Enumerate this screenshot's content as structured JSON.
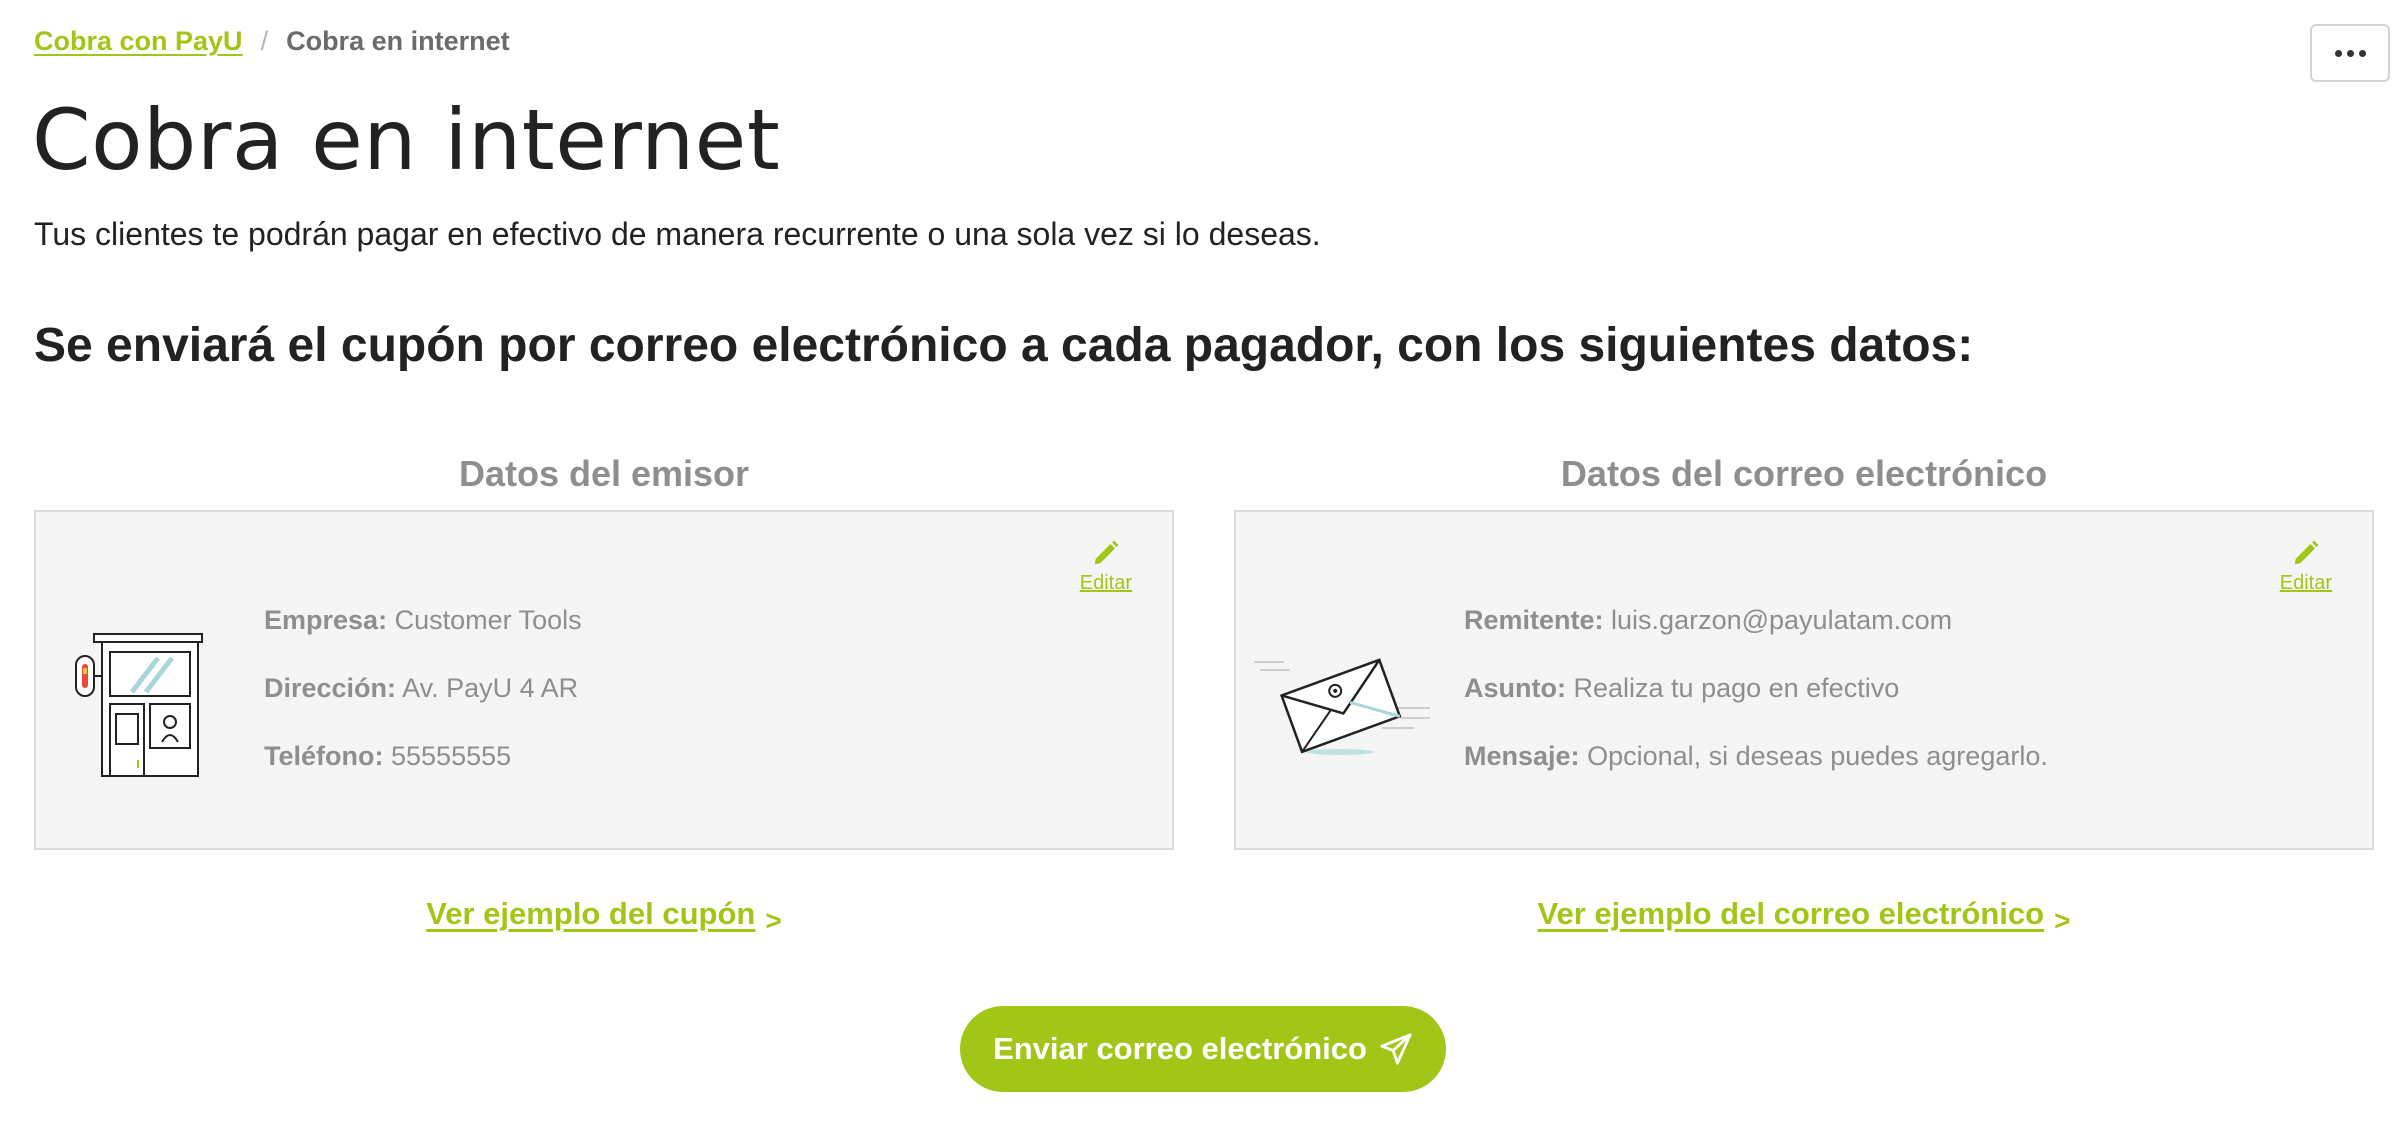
{
  "breadcrumb": {
    "parent_label": "Cobra con PayU",
    "separator": "/",
    "current_label": "Cobra en internet"
  },
  "more_button": {
    "icon": "ellipsis-icon"
  },
  "header": {
    "title": "Cobra en internet",
    "subtitle": "Tus clientes te podrán pagar en efectivo de manera recurrente o una sola vez si lo deseas."
  },
  "section": {
    "heading": "Se enviará el cupón por correo electrónico a cada pagador, con los siguientes datos:"
  },
  "issuer": {
    "title": "Datos del emisor",
    "edit_label": "Editar",
    "icon": "storefront-illustration",
    "company_label": "Empresa:",
    "company_value": "Customer Tools",
    "address_label": "Dirección:",
    "address_value": "Av. PayU 4 AR",
    "phone_label": "Teléfono:",
    "phone_value": "55555555",
    "example_link": "Ver ejemplo del cupón",
    "example_chevron": ">"
  },
  "email": {
    "title": "Datos del correo electrónico",
    "edit_label": "Editar",
    "icon": "envelope-illustration",
    "sender_label": "Remitente:",
    "sender_value": "luis.garzon@payulatam.com",
    "subject_label": "Asunto:",
    "subject_value": "Realiza tu pago en efectivo",
    "message_label": "Mensaje:",
    "message_value": "Opcional, si deseas puedes agregarlo.",
    "example_link": "Ver ejemplo del correo electrónico",
    "example_chevron": ">"
  },
  "send_button": {
    "label": "Enviar correo electrónico",
    "icon": "paper-plane-icon"
  },
  "colors": {
    "accent": "#a2c617",
    "card_bg": "#f5f5f5",
    "muted_text": "#8e8e8e"
  }
}
